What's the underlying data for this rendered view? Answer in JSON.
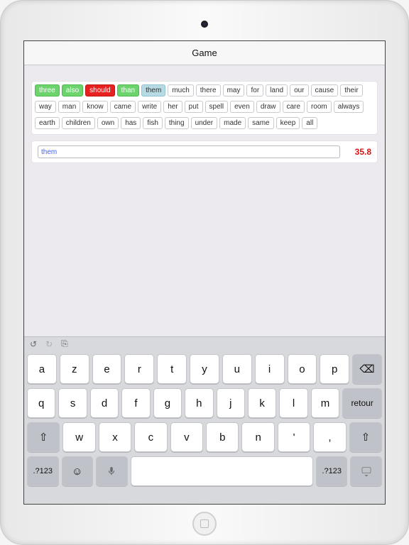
{
  "nav": {
    "title": "Game"
  },
  "words": [
    {
      "t": "three",
      "s": "correct"
    },
    {
      "t": "also",
      "s": "correct"
    },
    {
      "t": "should",
      "s": "wrong"
    },
    {
      "t": "than",
      "s": "correct"
    },
    {
      "t": "them",
      "s": "current"
    },
    {
      "t": "much",
      "s": ""
    },
    {
      "t": "there",
      "s": ""
    },
    {
      "t": "may",
      "s": ""
    },
    {
      "t": "for",
      "s": ""
    },
    {
      "t": "land",
      "s": ""
    },
    {
      "t": "our",
      "s": ""
    },
    {
      "t": "cause",
      "s": ""
    },
    {
      "t": "their",
      "s": ""
    },
    {
      "t": "way",
      "s": ""
    },
    {
      "t": "man",
      "s": ""
    },
    {
      "t": "know",
      "s": ""
    },
    {
      "t": "came",
      "s": ""
    },
    {
      "t": "write",
      "s": ""
    },
    {
      "t": "her",
      "s": ""
    },
    {
      "t": "put",
      "s": ""
    },
    {
      "t": "spell",
      "s": ""
    },
    {
      "t": "even",
      "s": ""
    },
    {
      "t": "draw",
      "s": ""
    },
    {
      "t": "care",
      "s": ""
    },
    {
      "t": "room",
      "s": ""
    },
    {
      "t": "always",
      "s": ""
    },
    {
      "t": "earth",
      "s": ""
    },
    {
      "t": "children",
      "s": ""
    },
    {
      "t": "own",
      "s": ""
    },
    {
      "t": "has",
      "s": ""
    },
    {
      "t": "fish",
      "s": ""
    },
    {
      "t": "thing",
      "s": ""
    },
    {
      "t": "under",
      "s": ""
    },
    {
      "t": "made",
      "s": ""
    },
    {
      "t": "same",
      "s": ""
    },
    {
      "t": "keep",
      "s": ""
    },
    {
      "t": "all",
      "s": ""
    }
  ],
  "input": {
    "value": "them"
  },
  "score": "35.8",
  "toolbar": {
    "undo": "↺",
    "redo": "↻",
    "clip": "⎘"
  },
  "keyboard": {
    "row1": [
      "a",
      "z",
      "e",
      "r",
      "t",
      "y",
      "u",
      "i",
      "o",
      "p"
    ],
    "row2": [
      "q",
      "s",
      "d",
      "f",
      "g",
      "h",
      "j",
      "k",
      "l",
      "m"
    ],
    "row3": [
      "w",
      "x",
      "c",
      "v",
      "b",
      "n",
      "'",
      ","
    ],
    "retour": "retour",
    "numkey": ".?123",
    "backspace": "⌫",
    "shift": "⇧",
    "emoji": "☺",
    "mic": "🎤",
    "kb": "⌨"
  }
}
